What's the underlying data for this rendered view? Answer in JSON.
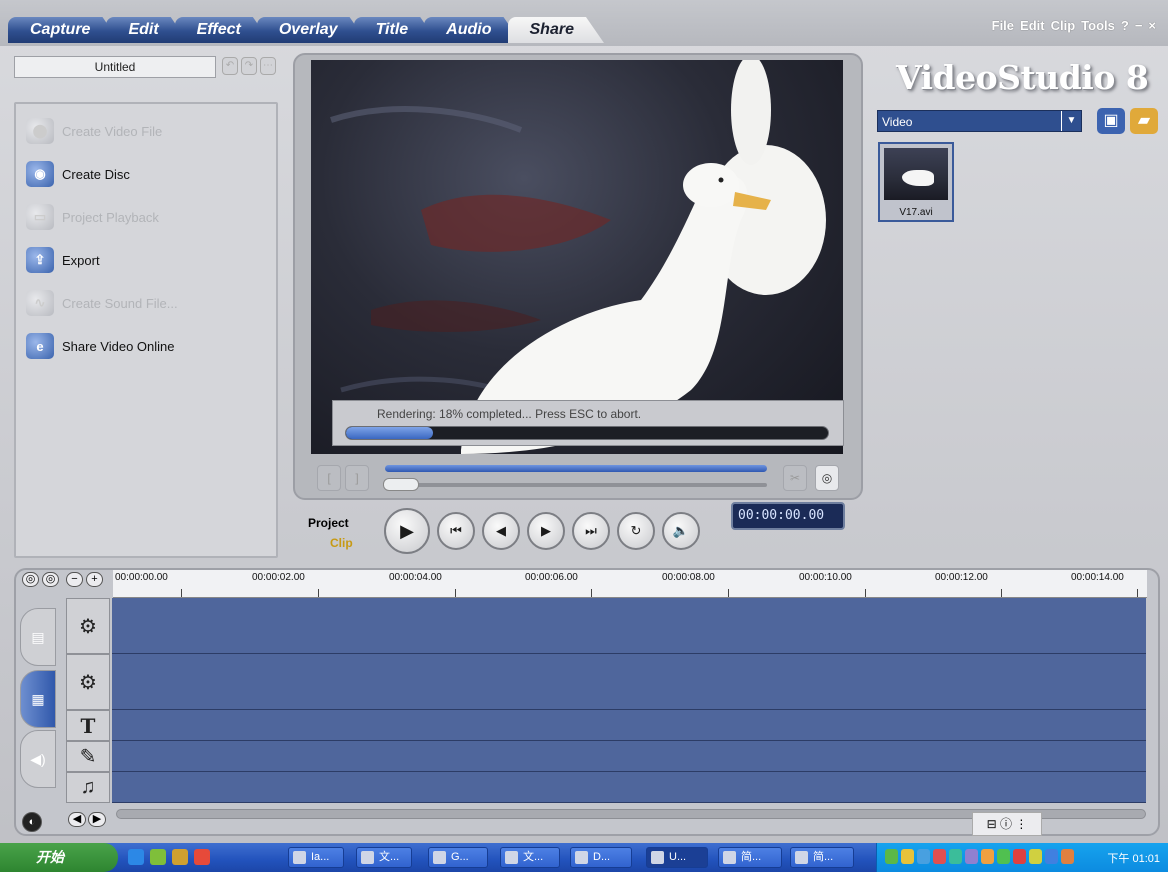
{
  "tabs": [
    {
      "label": "Capture"
    },
    {
      "label": "Edit"
    },
    {
      "label": "Effect"
    },
    {
      "label": "Overlay"
    },
    {
      "label": "Title"
    },
    {
      "label": "Audio"
    },
    {
      "label": "Share"
    }
  ],
  "menu": [
    "File",
    "Edit",
    "Clip",
    "Tools",
    "?",
    "−",
    "×"
  ],
  "project": {
    "title": "Untitled"
  },
  "share": {
    "items": [
      {
        "label": "Create Video File",
        "enabled": false,
        "icon": "film-reel-icon"
      },
      {
        "label": "Create Disc",
        "enabled": true,
        "icon": "disc-icon"
      },
      {
        "label": "Project Playback",
        "enabled": false,
        "icon": "monitor-icon"
      },
      {
        "label": "Export",
        "enabled": true,
        "icon": "export-icon"
      },
      {
        "label": "Create Sound File...",
        "enabled": false,
        "icon": "sound-wave-icon"
      },
      {
        "label": "Share Video Online",
        "enabled": true,
        "icon": "web-icon"
      }
    ]
  },
  "preview": {
    "render_text": "Rendering: 18% completed... Press ESC to abort.",
    "render_progress": 0.18,
    "timecode": "00:00:00.00"
  },
  "transport": {
    "project_label": "Project",
    "clip_label": "Clip"
  },
  "library": {
    "brand": "VideoStudio 8",
    "category": "Video",
    "items": [
      {
        "label": "V17.avi"
      }
    ]
  },
  "timeline": {
    "ruler": [
      "00:00:00.00",
      "00:00:02.00",
      "00:00:04.00",
      "00:00:06.00",
      "00:00:08.00",
      "00:00:10.00",
      "00:00:12.00",
      "00:00:14.00"
    ]
  },
  "taskbar": {
    "start_label": "开始",
    "tasks": [
      "Ia...",
      "文...",
      "G...",
      "文...",
      "D...",
      "U...",
      "简...",
      "简..."
    ],
    "clock": "下午 01:01"
  },
  "colors": {
    "accent": "#2f4f8f",
    "track": "#4f669c",
    "progress": "#3a67c1"
  }
}
